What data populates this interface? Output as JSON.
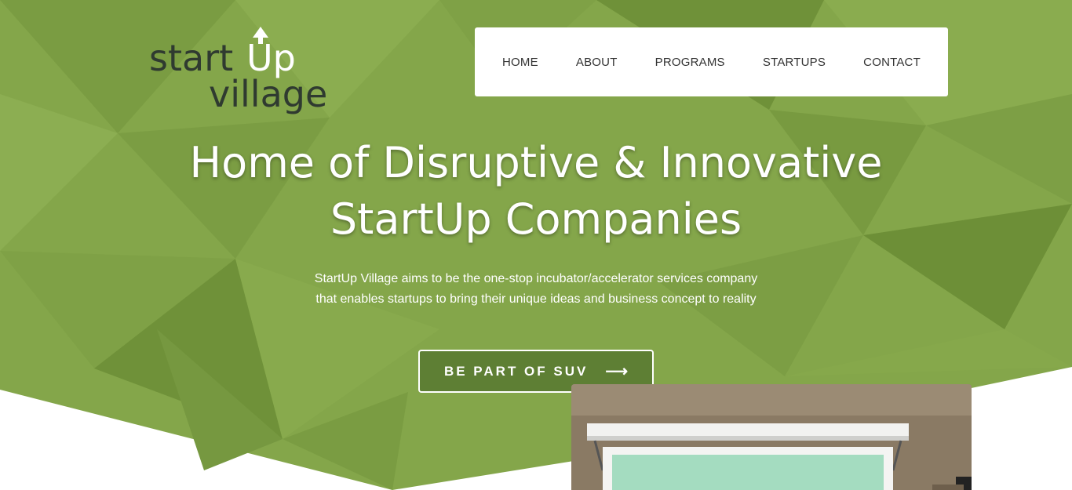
{
  "brand": {
    "logo_word_1": "startUp",
    "logo_word_2": "village"
  },
  "nav": {
    "items": [
      {
        "label": "HOME"
      },
      {
        "label": "ABOUT"
      },
      {
        "label": "PROGRAMS"
      },
      {
        "label": "STARTUPS"
      },
      {
        "label": "CONTACT"
      }
    ]
  },
  "hero": {
    "headline_line_1": "Home of Disruptive & Innovative",
    "headline_line_2": "StartUp Companies",
    "subtext_line_1": "StartUp Village aims to be the one-stop incubator/accelerator services company",
    "subtext_line_2": "that enables startups to bring their unique ideas and business concept to reality",
    "cta_label": "BE PART OF SUV",
    "cta_icon": "arrow-right-icon"
  },
  "colors": {
    "hero_green": "#84a64a",
    "hero_green_dark": "#6f9139",
    "cta_bg": "#5e7f34",
    "logo_dark": "#2f3a30",
    "nav_bg": "#ffffff"
  }
}
